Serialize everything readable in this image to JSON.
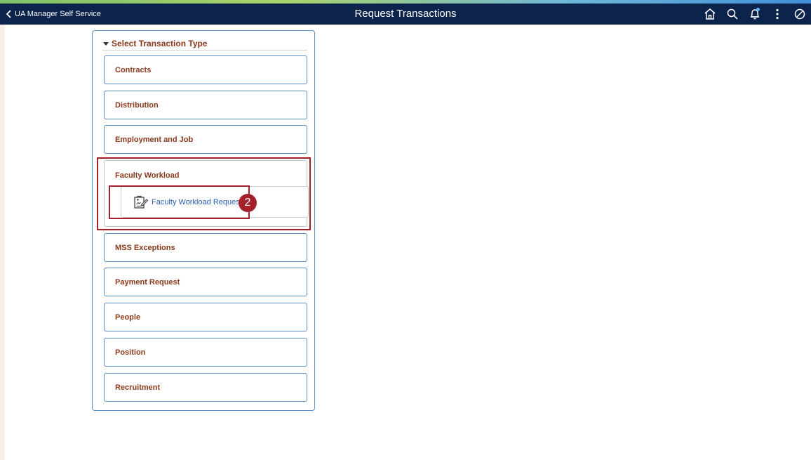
{
  "header": {
    "back_label": "UA Manager Self Service",
    "title": "Request Transactions",
    "actions": [
      "home-icon",
      "search-icon",
      "notification-bell-icon",
      "more-options-icon",
      "no-entry-icon"
    ]
  },
  "section": {
    "title": "Select Transaction Type",
    "tiles": [
      {
        "label": "Contracts"
      },
      {
        "label": "Distribution"
      },
      {
        "label": "Employment and Job"
      },
      {
        "label": "Faculty Workload",
        "expanded": true,
        "sub_items": [
          {
            "label": "Faculty Workload Request",
            "icon": "form-edit-icon"
          }
        ]
      },
      {
        "label": "MSS Exceptions"
      },
      {
        "label": "Payment Request"
      },
      {
        "label": "People"
      },
      {
        "label": "Position"
      },
      {
        "label": "Recruitment"
      }
    ]
  },
  "annotation": {
    "step_number": "2"
  },
  "colors": {
    "topbar": "#0c234b",
    "tile_label": "#8b3a1c",
    "tile_border": "#5b8fc7",
    "link": "#2a5fb0",
    "highlight": "#a5212a"
  }
}
